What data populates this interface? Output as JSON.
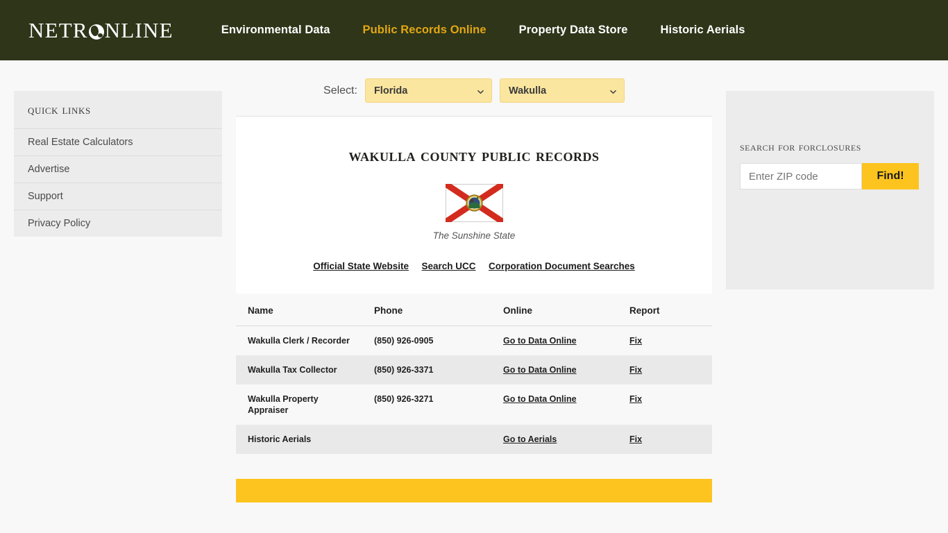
{
  "header": {
    "logo_text_pre": "NETR",
    "logo_icon": "globe-icon",
    "logo_text_post": "NLINE",
    "nav": [
      {
        "label": "Environmental Data",
        "active": false
      },
      {
        "label": "Public Records Online",
        "active": true
      },
      {
        "label": "Property Data Store",
        "active": false
      },
      {
        "label": "Historic Aerials",
        "active": false
      }
    ],
    "bg_color": "#2e3519",
    "active_color": "#e2a712"
  },
  "quick_links": {
    "title": "Quick Links",
    "items": [
      {
        "label": "Real Estate Calculators"
      },
      {
        "label": "Advertise"
      },
      {
        "label": "Support"
      },
      {
        "label": "Privacy Policy"
      }
    ]
  },
  "selector": {
    "label": "Select:",
    "state": {
      "value": "Florida",
      "options": [
        "Florida"
      ]
    },
    "county": {
      "value": "Wakulla",
      "options": [
        "Wakulla"
      ]
    },
    "bg_color": "#fbe6a0"
  },
  "main": {
    "title": "Wakulla County Public Records",
    "flag": {
      "name": "florida-state-flag",
      "caption": "The Sunshine State",
      "field_color": "#ffffff",
      "cross_color": "#d32b1e",
      "seal_color": "#c9a227"
    },
    "state_links": [
      {
        "label": "Official State Website"
      },
      {
        "label": "Search UCC"
      },
      {
        "label": "Corporation Document Searches"
      }
    ]
  },
  "records_table": {
    "columns": [
      "Name",
      "Phone",
      "Online",
      "Report"
    ],
    "rows": [
      {
        "name": "Wakulla Clerk / Recorder",
        "phone": "(850) 926-0905",
        "online": "Go to Data Online",
        "report": "Fix"
      },
      {
        "name": "Wakulla Tax Collector",
        "phone": "(850) 926-3371",
        "online": "Go to Data Online",
        "report": "Fix"
      },
      {
        "name": "Wakulla Property Appraiser",
        "phone": "(850) 926-3271",
        "online": "Go to Data Online",
        "report": "Fix"
      },
      {
        "name": "Historic Aerials",
        "phone": "",
        "online": "Go to Aerials",
        "report": "Fix"
      }
    ]
  },
  "foreclosure": {
    "title": "Search for Forclosures",
    "zip_placeholder": "Enter ZIP code",
    "zip_value": "",
    "button_label": "Find!",
    "button_color": "#fdc41f"
  }
}
